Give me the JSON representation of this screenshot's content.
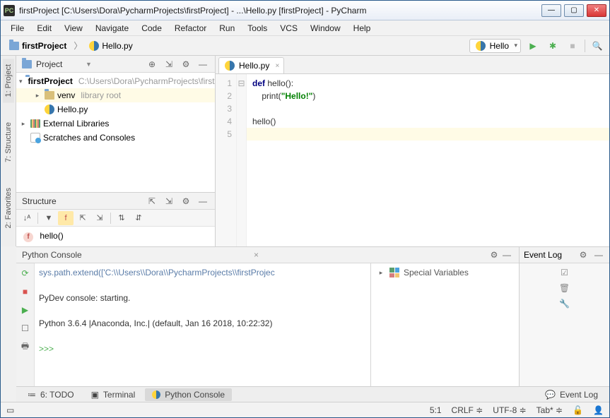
{
  "window": {
    "title": "firstProject [C:\\Users\\Dora\\PycharmProjects\\firstProject] - ...\\Hello.py [firstProject] - PyCharm"
  },
  "menu": [
    "File",
    "Edit",
    "View",
    "Navigate",
    "Code",
    "Refactor",
    "Run",
    "Tools",
    "VCS",
    "Window",
    "Help"
  ],
  "breadcrumb": {
    "project": "firstProject",
    "file": "Hello.py"
  },
  "run": {
    "config": "Hello"
  },
  "side_tabs": {
    "project": "1: Project",
    "structure": "7: Structure",
    "favorites": "2: Favorites"
  },
  "project_panel": {
    "title": "Project",
    "tree": {
      "root": {
        "name": "firstProject",
        "path": "C:\\Users\\Dora\\PycharmProjects\\firstProject"
      },
      "venv": {
        "name": "venv",
        "note": "library root"
      },
      "file": "Hello.py",
      "ext_lib": "External Libraries",
      "scratches": "Scratches and Consoles"
    }
  },
  "structure_panel": {
    "title": "Structure",
    "item": "hello()"
  },
  "editor": {
    "tab": "Hello.py",
    "lines": [
      "1",
      "2",
      "3",
      "4",
      "5"
    ],
    "code": {
      "l1a": "def ",
      "l1b": "hello():",
      "l2a": "    print(",
      "l2b": "\"Hello!\"",
      "l2c": ")",
      "l3": "",
      "l4": "hello()",
      "l5": ""
    }
  },
  "console": {
    "title": "Python Console",
    "line1": "sys.path.extend(['C:\\\\Users\\\\Dora\\\\PycharmProjects\\\\firstProjec",
    "line2": "PyDev console: starting.",
    "line3": "Python 3.6.4 |Anaconda, Inc.| (default, Jan 16 2018, 10:22:32)",
    "prompt": ">>>",
    "vars_label": "Special Variables"
  },
  "event_log": {
    "title": "Event Log"
  },
  "tool_tabs": {
    "todo": "6: TODO",
    "terminal": "Terminal",
    "console": "Python Console",
    "eventlog": "Event Log"
  },
  "status": {
    "pos": "5:1",
    "sep": "CRLF",
    "enc": "UTF-8",
    "indent": "Tab*"
  }
}
